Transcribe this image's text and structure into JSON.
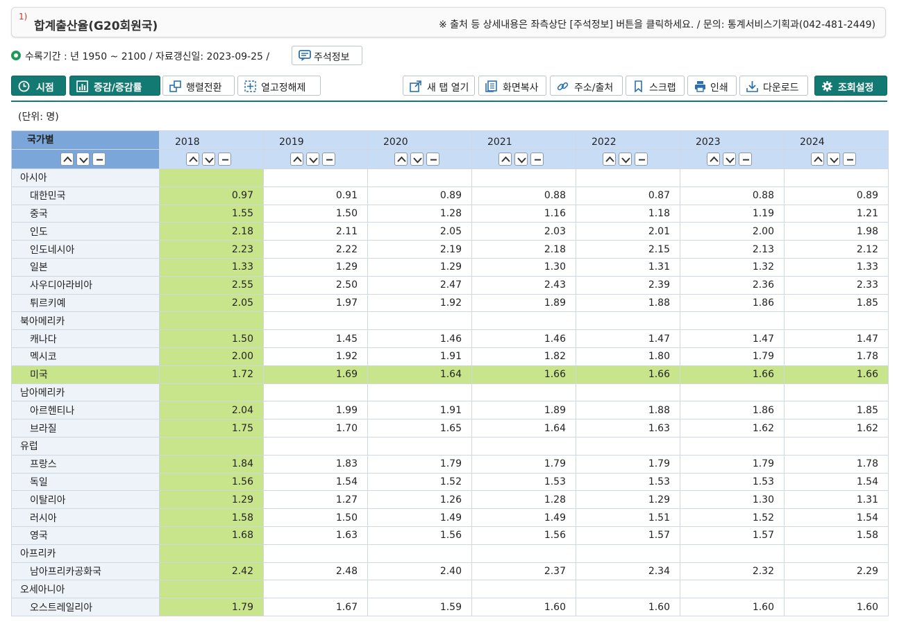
{
  "title": {
    "sup": "1)",
    "text": "합계출산율(G20회원국)",
    "notice": "※ 출처 등 상세내용은 좌측상단 [주석정보] 버튼을 클릭하세요. / 문의: 통계서비스기획과(042-481-2449)"
  },
  "info": {
    "text": "수록기간 : 년 1950 ~ 2100 / 자료갱신일: 2023-09-25 /",
    "footnote_button": "주석정보"
  },
  "toolbar": {
    "left": [
      {
        "label": "시점",
        "icon": "clock-icon"
      },
      {
        "label": "증감/증감률",
        "icon": "bar-chart-icon"
      },
      {
        "label": "행렬전환",
        "icon": "pivot-icon"
      },
      {
        "label": "열고정해제",
        "icon": "unfreeze-icon"
      }
    ],
    "right": [
      {
        "label": "새 탭 열기",
        "icon": "new-tab-icon"
      },
      {
        "label": "화면복사",
        "icon": "copy-icon"
      },
      {
        "label": "주소/출처",
        "icon": "link-icon"
      },
      {
        "label": "스크랩",
        "icon": "bookmark-icon"
      },
      {
        "label": "인쇄",
        "icon": "print-icon"
      },
      {
        "label": "다운로드",
        "icon": "download-icon"
      },
      {
        "label": "조회설정",
        "icon": "gear-icon"
      }
    ]
  },
  "unit": "(단위: 명)",
  "table": {
    "corner_label": "국가별",
    "years": [
      "2018",
      "2019",
      "2020",
      "2021",
      "2022",
      "2023",
      "2024"
    ],
    "rows": [
      {
        "name": "아시아",
        "group": true
      },
      {
        "name": "대한민국",
        "values": [
          "0.97",
          "0.91",
          "0.89",
          "0.88",
          "0.87",
          "0.88",
          "0.89"
        ]
      },
      {
        "name": "중국",
        "values": [
          "1.55",
          "1.50",
          "1.28",
          "1.16",
          "1.18",
          "1.19",
          "1.21"
        ]
      },
      {
        "name": "인도",
        "values": [
          "2.18",
          "2.11",
          "2.05",
          "2.03",
          "2.01",
          "2.00",
          "1.98"
        ]
      },
      {
        "name": "인도네시아",
        "values": [
          "2.23",
          "2.22",
          "2.19",
          "2.18",
          "2.15",
          "2.13",
          "2.12"
        ]
      },
      {
        "name": "일본",
        "values": [
          "1.33",
          "1.29",
          "1.29",
          "1.30",
          "1.31",
          "1.32",
          "1.33"
        ]
      },
      {
        "name": "사우디아라비아",
        "values": [
          "2.55",
          "2.50",
          "2.47",
          "2.43",
          "2.39",
          "2.36",
          "2.33"
        ]
      },
      {
        "name": "튀르키예",
        "values": [
          "2.05",
          "1.97",
          "1.92",
          "1.89",
          "1.88",
          "1.86",
          "1.85"
        ]
      },
      {
        "name": "북아메리카",
        "group": true
      },
      {
        "name": "캐나다",
        "values": [
          "1.50",
          "1.45",
          "1.46",
          "1.46",
          "1.47",
          "1.47",
          "1.47"
        ]
      },
      {
        "name": "멕시코",
        "values": [
          "2.00",
          "1.92",
          "1.91",
          "1.82",
          "1.80",
          "1.79",
          "1.78"
        ]
      },
      {
        "name": "미국",
        "highlight": true,
        "values": [
          "1.72",
          "1.69",
          "1.64",
          "1.66",
          "1.66",
          "1.66",
          "1.66"
        ]
      },
      {
        "name": "남아메리카",
        "group": true
      },
      {
        "name": "아르헨티나",
        "values": [
          "2.04",
          "1.99",
          "1.91",
          "1.89",
          "1.88",
          "1.86",
          "1.85"
        ]
      },
      {
        "name": "브라질",
        "values": [
          "1.75",
          "1.70",
          "1.65",
          "1.64",
          "1.63",
          "1.62",
          "1.62"
        ]
      },
      {
        "name": "유럽",
        "group": true
      },
      {
        "name": "프랑스",
        "values": [
          "1.84",
          "1.83",
          "1.79",
          "1.79",
          "1.79",
          "1.79",
          "1.78"
        ]
      },
      {
        "name": "독일",
        "values": [
          "1.56",
          "1.54",
          "1.52",
          "1.53",
          "1.53",
          "1.53",
          "1.54"
        ]
      },
      {
        "name": "이탈리아",
        "values": [
          "1.29",
          "1.27",
          "1.26",
          "1.28",
          "1.29",
          "1.30",
          "1.31"
        ]
      },
      {
        "name": "러시아",
        "values": [
          "1.58",
          "1.50",
          "1.49",
          "1.49",
          "1.51",
          "1.52",
          "1.54"
        ]
      },
      {
        "name": "영국",
        "values": [
          "1.68",
          "1.63",
          "1.56",
          "1.56",
          "1.57",
          "1.57",
          "1.58"
        ]
      },
      {
        "name": "아프리카",
        "group": true
      },
      {
        "name": "남아프리카공화국",
        "values": [
          "2.42",
          "2.48",
          "2.40",
          "2.37",
          "2.34",
          "2.32",
          "2.29"
        ]
      },
      {
        "name": "오세아니아",
        "group": true
      },
      {
        "name": "오스트레일리아",
        "values": [
          "1.79",
          "1.67",
          "1.59",
          "1.60",
          "1.60",
          "1.60",
          "1.60"
        ]
      }
    ]
  },
  "colors": {
    "accent": "#127a73",
    "header": "#c9dcf5",
    "corner": "#7aa6d9",
    "highlight": "#c9e58c"
  }
}
